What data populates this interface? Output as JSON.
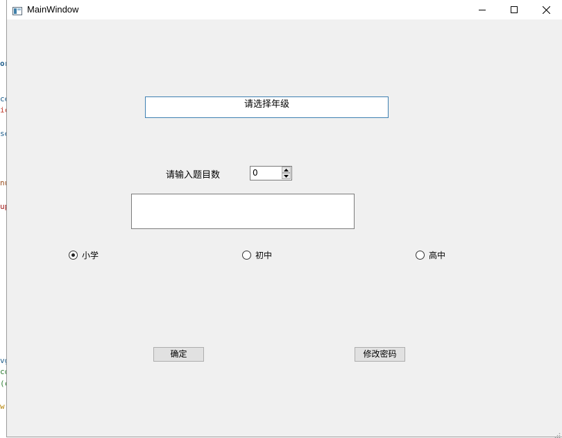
{
  "window": {
    "title": "MainWindow"
  },
  "background_fragments": [
    {
      "text": "or",
      "color": "#1f5e8c"
    },
    {
      "text": "ce",
      "color": "#1f5e8c"
    },
    {
      "text": "ic",
      "color": "#c0392b"
    },
    {
      "text": "se",
      "color": "#1f5e8c"
    },
    {
      "text": "nu",
      "color": "#9b4f1f"
    },
    {
      "text": "up",
      "color": "#a01818"
    },
    {
      "text": "vg",
      "color": "#1f5e8c"
    },
    {
      "text": "co",
      "color": "#2e7d32"
    },
    {
      "text": "(c",
      "color": "#2e7d32"
    },
    {
      "text": "w",
      "color": "#b8860b"
    }
  ],
  "form": {
    "grade_prompt": "请选择年级",
    "count_label": "请输入题目数",
    "count_value": "0",
    "text_area_value": "",
    "radios": [
      {
        "label": "小学",
        "checked": true
      },
      {
        "label": "初中",
        "checked": false
      },
      {
        "label": "高中",
        "checked": false
      }
    ],
    "ok_button": "确定",
    "change_password_button": "修改密码"
  }
}
